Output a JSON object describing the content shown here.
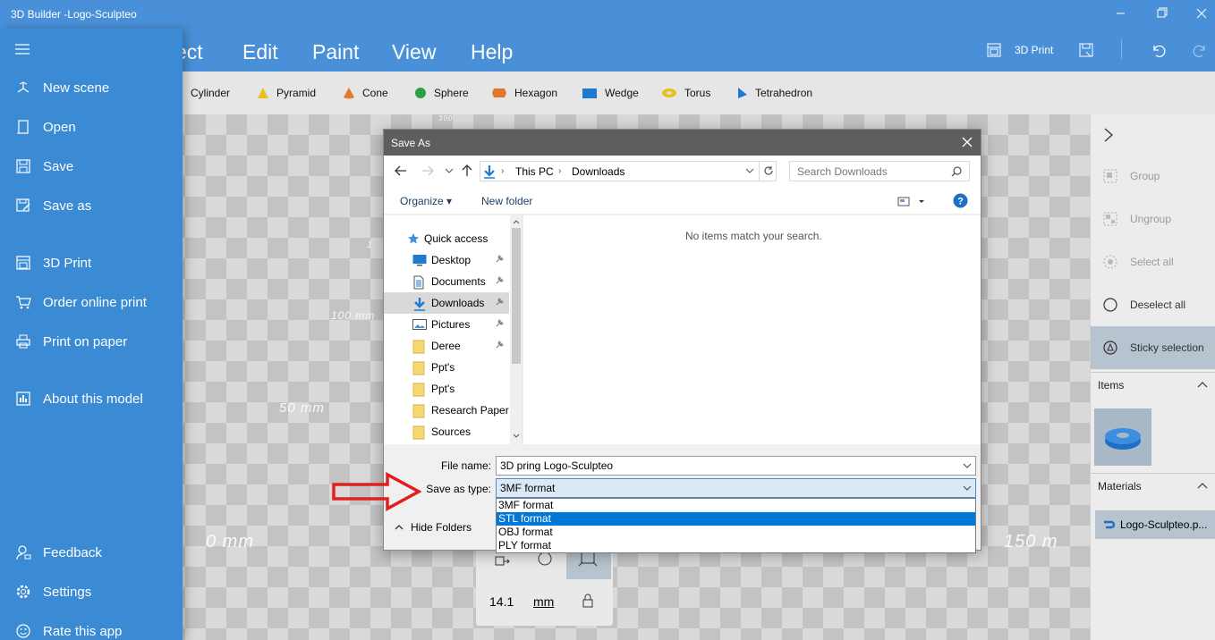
{
  "app": {
    "title": "3D Builder -Logo-Sculpteo"
  },
  "menu": {
    "items": [
      "ect",
      "Edit",
      "Paint",
      "View",
      "Help"
    ],
    "print_label": "3D Print"
  },
  "shapes": [
    "Cylinder",
    "Pyramid",
    "Cone",
    "Sphere",
    "Hexagon",
    "Wedge",
    "Torus",
    "Tetrahedron"
  ],
  "viewport": {
    "labels": [
      "300 ......",
      "1",
      "100 mm",
      "50 mm",
      "0 mm",
      "150 m"
    ]
  },
  "sidebar": {
    "items": [
      {
        "label": "New scene",
        "icon": "new-scene-icon"
      },
      {
        "label": "Open",
        "icon": "open-icon"
      },
      {
        "label": "Save",
        "icon": "save-icon"
      },
      {
        "label": "Save as",
        "icon": "save-as-icon"
      },
      {
        "label": "3D Print",
        "icon": "3d-print-icon"
      },
      {
        "label": "Order online print",
        "icon": "cart-icon"
      },
      {
        "label": "Print on paper",
        "icon": "printer-icon"
      },
      {
        "label": "About this model",
        "icon": "info-icon"
      }
    ],
    "bottom": [
      {
        "label": "Feedback",
        "icon": "feedback-icon"
      },
      {
        "label": "Settings",
        "icon": "settings-icon"
      },
      {
        "label": "Rate this app",
        "icon": "smiley-icon"
      }
    ]
  },
  "right_panel": {
    "group": "Group",
    "ungroup": "Ungroup",
    "select_all": "Select all",
    "deselect_all": "Deselect all",
    "sticky": "Sticky selection",
    "items_header": "Items",
    "materials_header": "Materials",
    "material_name": "Logo-Sculpteo.p..."
  },
  "toolbox": {
    "value": "14.1",
    "unit": "mm"
  },
  "dialog": {
    "title": "Save As",
    "breadcrumb": [
      "This PC",
      "Downloads"
    ],
    "search_placeholder": "Search Downloads",
    "organize": "Organize ▾",
    "new_folder": "New folder",
    "empty_message": "No items match your search.",
    "nav": [
      {
        "label": "Quick access",
        "pinned": false,
        "selected": false
      },
      {
        "label": "Desktop",
        "pinned": true,
        "selected": false
      },
      {
        "label": "Documents",
        "pinned": true,
        "selected": false
      },
      {
        "label": "Downloads",
        "pinned": true,
        "selected": true
      },
      {
        "label": "Pictures",
        "pinned": true,
        "selected": false
      },
      {
        "label": "Deree",
        "pinned": true,
        "selected": false
      },
      {
        "label": "Ppt's",
        "pinned": false,
        "selected": false
      },
      {
        "label": "Ppt's",
        "pinned": false,
        "selected": false
      },
      {
        "label": "Research Paper",
        "pinned": false,
        "selected": false
      },
      {
        "label": "Sources",
        "pinned": false,
        "selected": false
      }
    ],
    "file_name_label": "File name:",
    "file_name_value": "3D pring Logo-Sculpteo",
    "save_type_label": "Save as type:",
    "save_type_value": "3MF format",
    "type_options": [
      "3MF format",
      "STL format",
      "OBJ format",
      "PLY format"
    ],
    "type_selected_index": 1,
    "hide_folders": "Hide Folders"
  },
  "colors": {
    "accent": "#4a90d9",
    "sidebar": "#3a8ad4",
    "highlight": "#0078d7",
    "arrow": "#e02020"
  }
}
